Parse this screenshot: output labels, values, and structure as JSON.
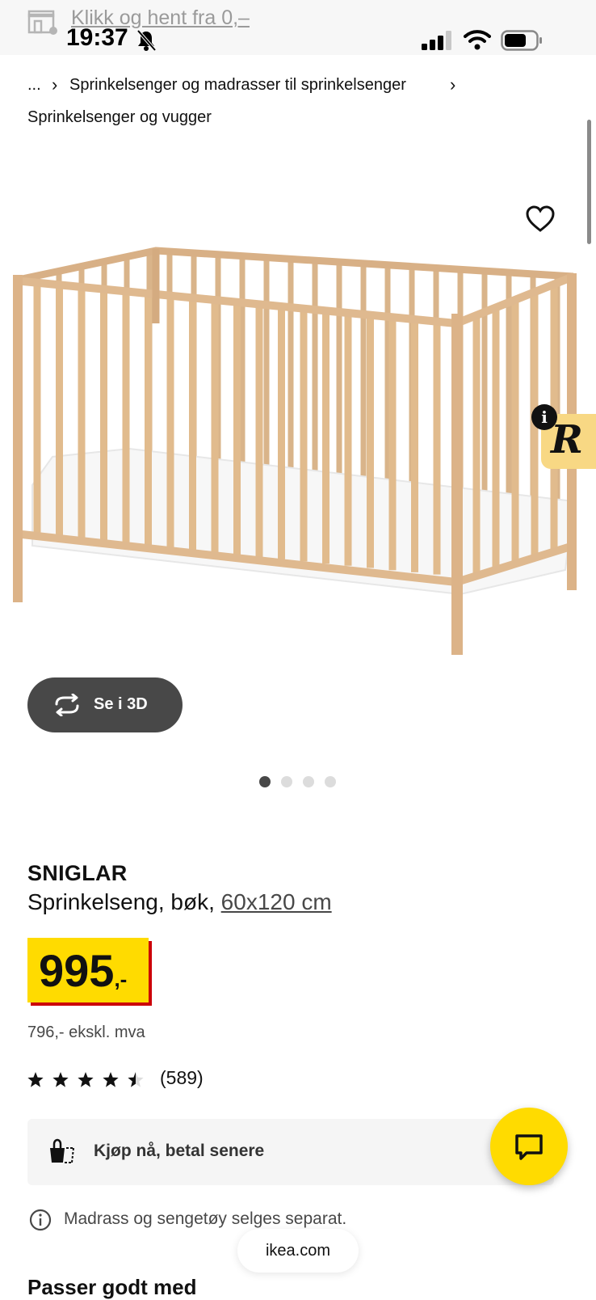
{
  "status_bar": {
    "banner_text": "Klikk og hent fra 0,–",
    "time": "19:37"
  },
  "breadcrumb": {
    "ellipsis": "...",
    "level1": "Sprinkelsenger og madrasser til sprinkelsenger",
    "current": "Sprinkelsenger og vugger"
  },
  "gallery": {
    "view_3d_label": "Se i 3D",
    "image_count": 4,
    "active_index": 0
  },
  "badges": {
    "info_letter": "i",
    "r_letter": "R"
  },
  "product": {
    "brand": "SNIGLAR",
    "description": "Sprinkelseng, bøk, ",
    "size": "60x120 cm",
    "price_main": "995",
    "price_suffix": ",-",
    "price_excl_vat": "796,- ekskl. mva",
    "rating": 4.5,
    "rating_max": 5,
    "review_count": "(589)"
  },
  "bnpl": {
    "label": "Kjøp nå, betal senere"
  },
  "notice": {
    "text": "Madrass og sengetøy selges separat."
  },
  "browser": {
    "url": "ikea.com"
  },
  "sections": {
    "goes_well_with": "Passer godt med"
  },
  "colors": {
    "price_yellow": "#ffdb00",
    "price_red": "#cc0008",
    "button_dark": "#484848"
  }
}
